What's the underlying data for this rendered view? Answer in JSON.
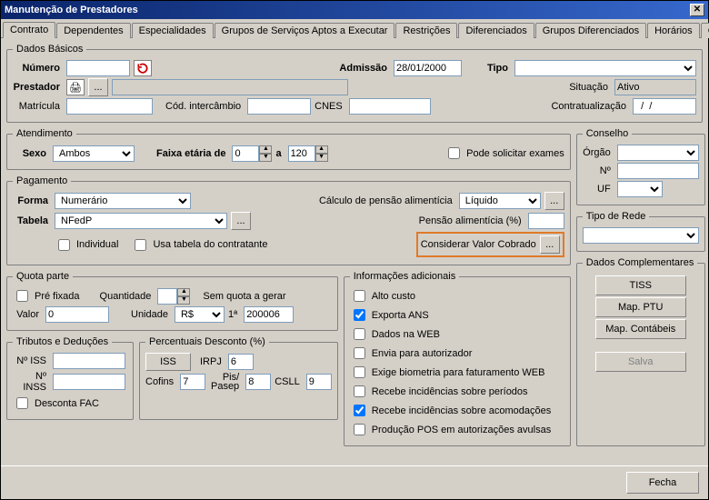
{
  "window": {
    "title": "Manutenção de Prestadores",
    "close_char": "✕"
  },
  "tabs": {
    "items": [
      "Contrato",
      "Dependentes",
      "Especialidades",
      "Grupos de Serviços Aptos a Executar",
      "Restrições",
      "Diferenciados",
      "Grupos Diferenciados",
      "Horários",
      "Conc"
    ],
    "nav_left": "◄",
    "nav_right": "►"
  },
  "dados_basicos": {
    "legend": "Dados Básicos",
    "numero_label": "Número",
    "numero_value": "",
    "admissao_label": "Admissão",
    "admissao_value": "28/01/2000",
    "tipo_label": "Tipo",
    "tipo_value": "",
    "prestador_label": "Prestador",
    "prestador_nome": "",
    "situacao_label": "Situação",
    "situacao_value": "Ativo",
    "matricula_label": "Matrícula",
    "matricula_value": "",
    "cod_intercambio_label": "Cód. intercâmbio",
    "cod_intercambio_value": "",
    "cnes_label": "CNES",
    "cnes_value": "",
    "contratualizacao_label": "Contratualização",
    "contratualizacao_value": "  /  /"
  },
  "atendimento": {
    "legend": "Atendimento",
    "sexo_label": "Sexo",
    "sexo_value": "Ambos",
    "faixa_label": "Faixa etária de",
    "faixa_a": "a",
    "faixa_min": "0",
    "faixa_max": "120",
    "pode_solicitar": "Pode solicitar exames"
  },
  "conselho": {
    "legend": "Conselho",
    "orgao_label": "Órgão",
    "n_label": "Nº",
    "uf_label": "UF"
  },
  "pagamento": {
    "legend": "Pagamento",
    "forma_label": "Forma",
    "forma_value": "Numerário",
    "calculo_label": "Cálculo de pensão alimentícia",
    "calculo_value": "Líquido",
    "tabela_label": "Tabela",
    "tabela_value": "NFedP",
    "pensao_pct_label": "Pensão alimentícia (%)",
    "pensao_pct_value": "",
    "individual_label": "Individual",
    "usa_tabela_label": "Usa tabela do contratante",
    "considerar_label": "Considerar Valor Cobrado",
    "dots": "..."
  },
  "tipo_rede": {
    "legend": "Tipo de Rede"
  },
  "quota": {
    "legend": "Quota parte",
    "pre_fixada": "Pré fixada",
    "quantidade_label": "Quantidade",
    "sem_quota": "Sem quota a gerar",
    "valor_label": "Valor",
    "valor_value": "0",
    "unidade_label": "Unidade",
    "unidade_value": "R$",
    "primeira_label": "1ª",
    "primeira_value": "200006"
  },
  "informacoes": {
    "legend": "Informações adicionais",
    "alto_custo": "Alto custo",
    "exporta_ans": "Exporta ANS",
    "dados_web": "Dados na WEB",
    "envia_autorizador": "Envia para autorizador",
    "exige_biometria": "Exige biometria para faturamento WEB",
    "recebe_periodos": "Recebe incidências sobre períodos",
    "recebe_acomodacoes": "Recebe incidências sobre acomodações",
    "producao_pos": "Produção POS em autorizações avulsas"
  },
  "complementares": {
    "legend": "Dados Complementares",
    "tiss": "TISS",
    "map_ptu": "Map. PTU",
    "map_contabeis": "Map. Contábeis",
    "salva": "Salva"
  },
  "tributos": {
    "legend": "Tributos e Deduções",
    "n_iss_label": "Nº ISS",
    "n_inss_label": "Nº INSS",
    "desconta_fac": "Desconta FAC"
  },
  "percentuais": {
    "legend": "Percentuais Desconto (%)",
    "iss_btn": "ISS",
    "irpj_label": "IRPJ",
    "irpj_value": "6",
    "cofins_label": "Cofins",
    "cofins_value": "7",
    "pis_label": "Pis/ Pasep",
    "pis_value": "8",
    "csll_label": "CSLL",
    "csll_value": "9"
  },
  "footer": {
    "fecha": "Fecha"
  },
  "icons": {
    "printer": "🖨",
    "refresh_color": "#c00"
  }
}
